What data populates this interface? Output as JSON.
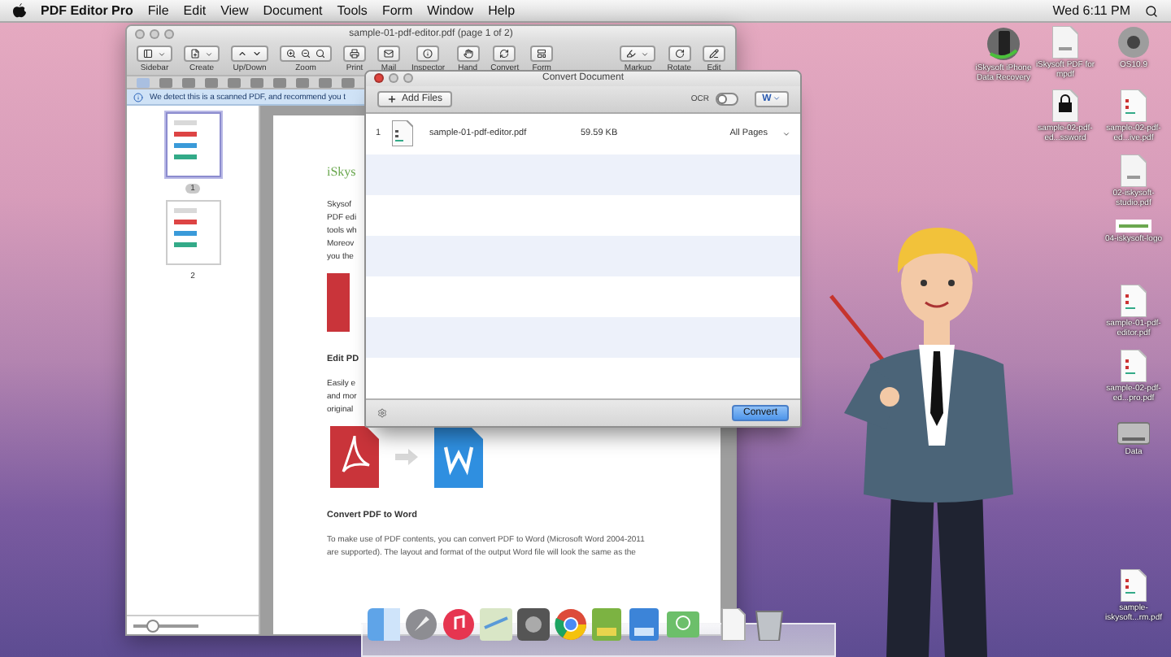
{
  "menubar": {
    "app": "PDF Editor Pro",
    "menus": [
      "File",
      "Edit",
      "View",
      "Document",
      "Tools",
      "Form",
      "Window",
      "Help"
    ],
    "clock": "Wed 6:11 PM"
  },
  "editor_window": {
    "title": "sample-01-pdf-editor.pdf (page 1 of 2)",
    "toolbar_left": [
      {
        "label": "Sidebar",
        "kind": "dropdown"
      },
      {
        "label": "Create",
        "kind": "dropdown"
      },
      {
        "label": "Up/Down",
        "kind": "double"
      },
      {
        "label": "Zoom",
        "kind": "triple"
      },
      {
        "label": "Print",
        "kind": "single"
      },
      {
        "label": "Mail",
        "kind": "single"
      },
      {
        "label": "Inspector",
        "kind": "single"
      },
      {
        "label": "Hand",
        "kind": "single"
      },
      {
        "label": "Convert",
        "kind": "single"
      },
      {
        "label": "Form",
        "kind": "single"
      }
    ],
    "toolbar_right": [
      {
        "label": "Markup",
        "kind": "dropdown"
      },
      {
        "label": "Rotate",
        "kind": "single"
      },
      {
        "label": "Edit",
        "kind": "single"
      }
    ],
    "thumbnail_size": {
      "level": 0.3
    },
    "notice": "We detect this is a scanned PDF, and recommend you t",
    "thumbnails": [
      {
        "label": "1",
        "selected": true
      },
      {
        "label": "2",
        "selected": false
      }
    ],
    "page": {
      "heading": "iSkys",
      "intro_lines": [
        "Skysof",
        "PDF edi",
        "tools wh",
        "Moreov",
        "you the"
      ],
      "section_1": "Edit PD",
      "section_1_lines": [
        "Easily e",
        "and mor",
        "original"
      ],
      "section_2": "Convert PDF to Word",
      "section_2_lines": [
        "To make use of PDF contents, you can convert PDF to Word (Microsoft Word 2004-2011",
        "are supported). The layout and format of the output Word file will look the same as the"
      ]
    }
  },
  "convert_dialog": {
    "title": "Convert Document",
    "add_button": "Add Files",
    "ocr_label": "OCR",
    "ocr_on": false,
    "format": "W",
    "files": [
      {
        "index": "1",
        "name": "sample-01-pdf-editor.pdf",
        "size": "59.59 KB",
        "pages": "All Pages"
      }
    ],
    "convert_button": "Convert"
  },
  "desktop_icons": [
    {
      "label": "iSkysoft iPhone Data Recovery",
      "kind": "app"
    },
    {
      "label": "iSkysoft PDF for mpdf",
      "kind": "pdf"
    },
    {
      "label": "OS10.9",
      "kind": "disc"
    },
    {
      "label": "sample-02-pdf-ed...ssword",
      "kind": "locked"
    },
    {
      "label": "sample-02-pdf-ed...ive.pdf",
      "kind": "doc"
    },
    {
      "label": "02-iskysoft-studio.pdf",
      "kind": "pdf"
    },
    {
      "label": "04-iskysoft-logo",
      "kind": "logo"
    },
    {
      "label": "sample-01-pdf-editor.pdf",
      "kind": "doc"
    },
    {
      "label": "sample-02-pdf-ed...pro.pdf",
      "kind": "doc"
    },
    {
      "label": "Data",
      "kind": "drive"
    },
    {
      "label": "sample-iskysoft...rm.pdf",
      "kind": "doc"
    }
  ]
}
